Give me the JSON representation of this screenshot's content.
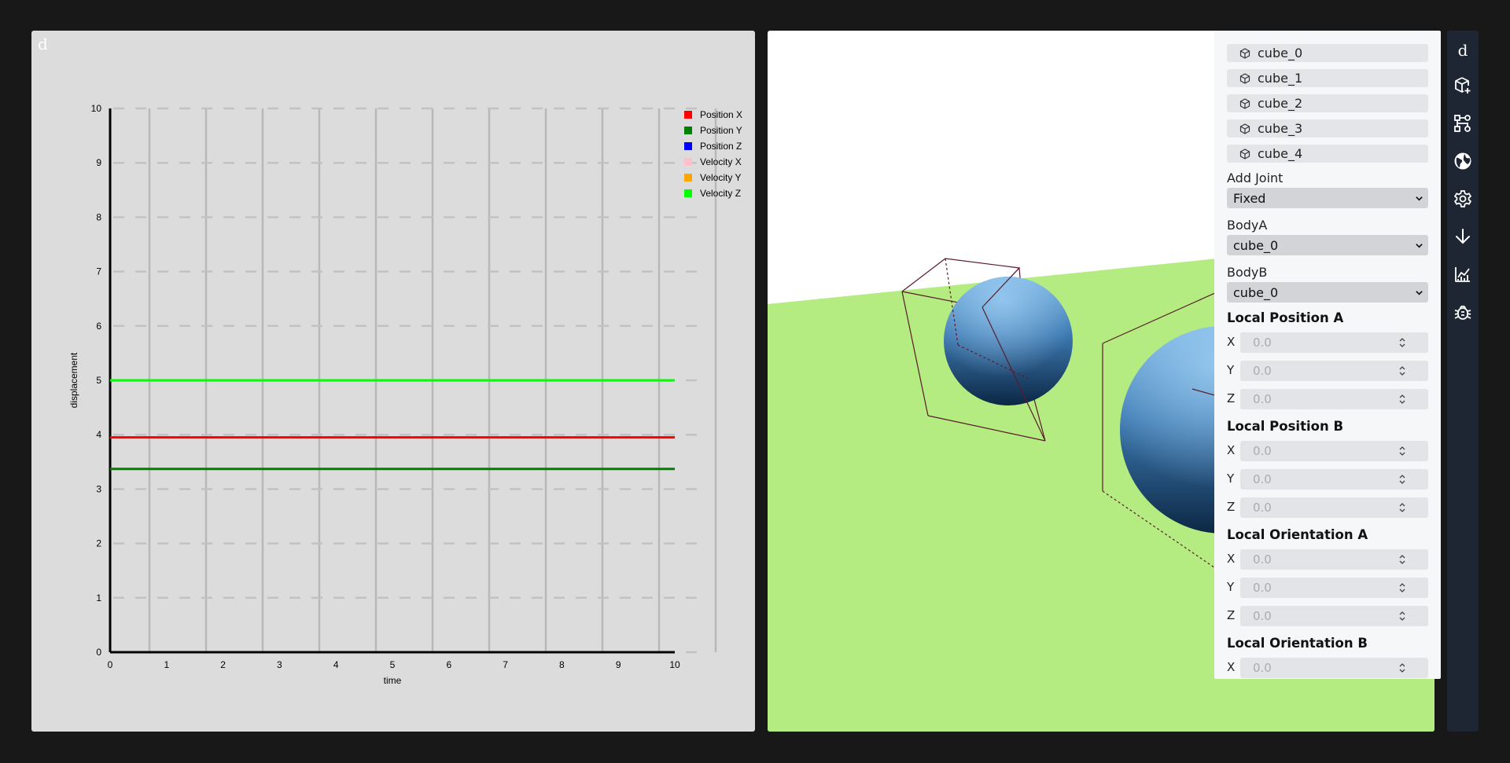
{
  "app": {
    "logo_glyph": "d"
  },
  "chart_panel": {
    "chart_data": {
      "type": "line",
      "xlabel": "time",
      "ylabel": "displacement",
      "xlim": [
        0,
        10
      ],
      "ylim": [
        0,
        10
      ],
      "x_ticks": [
        "0",
        "1",
        "2",
        "3",
        "4",
        "5",
        "6",
        "7",
        "8",
        "9",
        "10"
      ],
      "y_ticks": [
        "0",
        "1",
        "2",
        "3",
        "4",
        "5",
        "6",
        "7",
        "8",
        "9",
        "10"
      ],
      "grid": true,
      "legend_position": "top-right",
      "series": [
        {
          "name": "Position X",
          "color": "#ff0000",
          "x": [
            0,
            10
          ],
          "values": [
            3.95,
            3.95
          ]
        },
        {
          "name": "Position Y",
          "color": "#008000",
          "x": [
            0,
            10
          ],
          "values": [
            3.37,
            3.37
          ]
        },
        {
          "name": "Position Z",
          "color": "#0000ff",
          "x": [],
          "values": []
        },
        {
          "name": "Velocity X",
          "color": "#ffc0cb",
          "x": [],
          "values": []
        },
        {
          "name": "Velocity Y",
          "color": "#ffa500",
          "x": [],
          "values": []
        },
        {
          "name": "Velocity Z",
          "color": "#00ff00",
          "x": [
            0,
            10
          ],
          "values": [
            5.0,
            5.0
          ]
        }
      ]
    }
  },
  "viewport": {
    "ground_color": "#b5ec82",
    "sky_color": "#ffffff",
    "sphere_color": "#3f7fb8",
    "wireframe_color": "#5a1a2a"
  },
  "joint_panel": {
    "bodies": [
      {
        "label": "cube_0",
        "icon": "cube-icon"
      },
      {
        "label": "cube_1",
        "icon": "cube-icon"
      },
      {
        "label": "cube_2",
        "icon": "cube-icon"
      },
      {
        "label": "cube_3",
        "icon": "cube-icon"
      },
      {
        "label": "cube_4",
        "icon": "cube-icon"
      }
    ],
    "add_joint_label": "Add Joint",
    "joint_type": "Fixed",
    "body_a_label": "BodyA",
    "body_a_value": "cube_0",
    "body_b_label": "BodyB",
    "body_b_value": "cube_0",
    "sections": [
      {
        "title": "Local Position A",
        "fields": [
          {
            "axis": "X",
            "placeholder": "0.0"
          },
          {
            "axis": "Y",
            "placeholder": "0.0"
          },
          {
            "axis": "Z",
            "placeholder": "0.0"
          }
        ]
      },
      {
        "title": "Local Position B",
        "fields": [
          {
            "axis": "X",
            "placeholder": "0.0"
          },
          {
            "axis": "Y",
            "placeholder": "0.0"
          },
          {
            "axis": "Z",
            "placeholder": "0.0"
          }
        ]
      },
      {
        "title": "Local Orientation A",
        "fields": [
          {
            "axis": "X",
            "placeholder": "0.0"
          },
          {
            "axis": "Y",
            "placeholder": "0.0"
          },
          {
            "axis": "Z",
            "placeholder": "0.0"
          }
        ]
      },
      {
        "title": "Local Orientation B",
        "fields": [
          {
            "axis": "X",
            "placeholder": "0.0"
          }
        ]
      }
    ]
  },
  "toolbar": {
    "logo_glyph": "d",
    "buttons": [
      "add-cube-icon",
      "joint-graph-icon",
      "globe-icon",
      "settings-gear-icon",
      "download-arrow-icon",
      "chart-icon",
      "bug-icon"
    ]
  }
}
